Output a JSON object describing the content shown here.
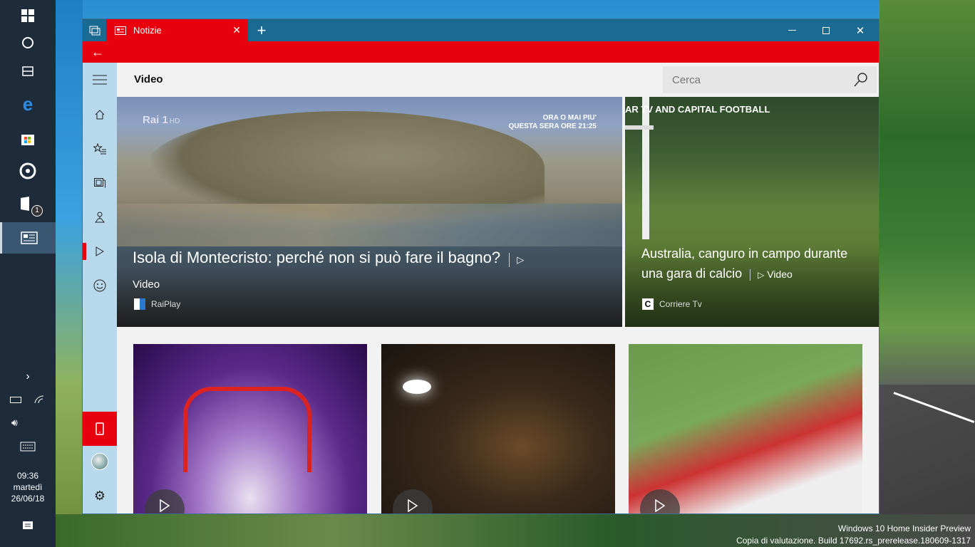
{
  "taskbar": {
    "items": [
      "start-icon",
      "cortana-icon",
      "task-view-icon",
      "edge-icon",
      "store-icon",
      "groove-icon",
      "mail-icon",
      "news-icon"
    ],
    "mail_badge": "1",
    "clock": {
      "time": "09:36",
      "day": "martedì",
      "date": "26/06/18"
    }
  },
  "window": {
    "tab_label": "Notizie",
    "page_title": "Video",
    "search_placeholder": "Cerca"
  },
  "hero": {
    "channel": "Rai 1",
    "channel_hd": "HD",
    "promo_line1": "ORA O MAI PIU'",
    "promo_line2": "QUESTA SERA ORE 21:25",
    "title": "Isola di Montecristo: perché non si può fare il bagno?",
    "video_label": "Video",
    "source": "RaiPlay"
  },
  "side_card": {
    "banner": "AR TV AND CAPITAL FOOTBALL",
    "title": "Australia, canguro in campo durante una gara di calcio",
    "video_label": "Video",
    "source": "Corriere Tv"
  },
  "desktop": {
    "watermark_line1": "Windows 10 Home Insider Preview",
    "watermark_line2": "Copia di valutazione. Build 17692.rs_prerelease.180609-1317"
  }
}
